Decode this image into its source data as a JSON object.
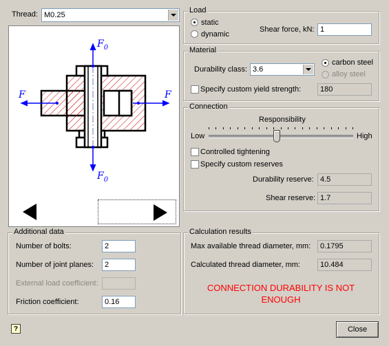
{
  "thread": {
    "label": "Thread:",
    "value": "M0.25"
  },
  "diagram": {
    "force_top": "F",
    "force_top_sub": "0",
    "force_left": "F",
    "force_right": "F",
    "force_bottom": "F",
    "force_bottom_sub": "0"
  },
  "load": {
    "title": "Load",
    "static_label": "static",
    "dynamic_label": "dynamic",
    "selected": "static",
    "shear_force_label": "Shear force, kN:",
    "shear_force_value": "1"
  },
  "material": {
    "title": "Material",
    "durability_label": "Durability class:",
    "durability_value": "3.6",
    "carbon_steel_label": "carbon steel",
    "alloy_steel_label": "alloy steel",
    "selected": "carbon steel",
    "custom_yield_label": "Specify custom yield strength:",
    "custom_yield_value": "180"
  },
  "connection": {
    "title": "Connection",
    "responsibility_label": "Responsibility",
    "low_label": "Low",
    "high_label": "High",
    "responsibility_level": 0.47,
    "controlled_tightening_label": "Controlled tightening",
    "custom_reserves_label": "Specify custom reserves",
    "durability_reserve_label": "Durability reserve:",
    "durability_reserve_value": "4.5",
    "shear_reserve_label": "Shear reserve:",
    "shear_reserve_value": "1.7"
  },
  "additional": {
    "title": "Additional data",
    "bolts_label": "Number of bolts:",
    "bolts_value": "2",
    "planes_label": "Number of joint planes:",
    "planes_value": "2",
    "ext_load_label": "External load coefficient:",
    "ext_load_value": "",
    "friction_label": "Friction coefficient:",
    "friction_value": "0.16"
  },
  "results": {
    "title": "Calculation results",
    "max_diam_label": "Max available thread diameter, mm:",
    "max_diam_value": "0.1795",
    "calc_diam_label": "Calculated thread diameter, mm:",
    "calc_diam_value": "10.484",
    "message_line1": "CONNECTION DURABILITY IS NOT",
    "message_line2": "ENOUGH"
  },
  "footer": {
    "help_icon": "?",
    "close_label": "Close"
  },
  "colors": {
    "warning": "#ff0000",
    "force_arrow": "#0000ff",
    "hatch": "#cc0000"
  }
}
